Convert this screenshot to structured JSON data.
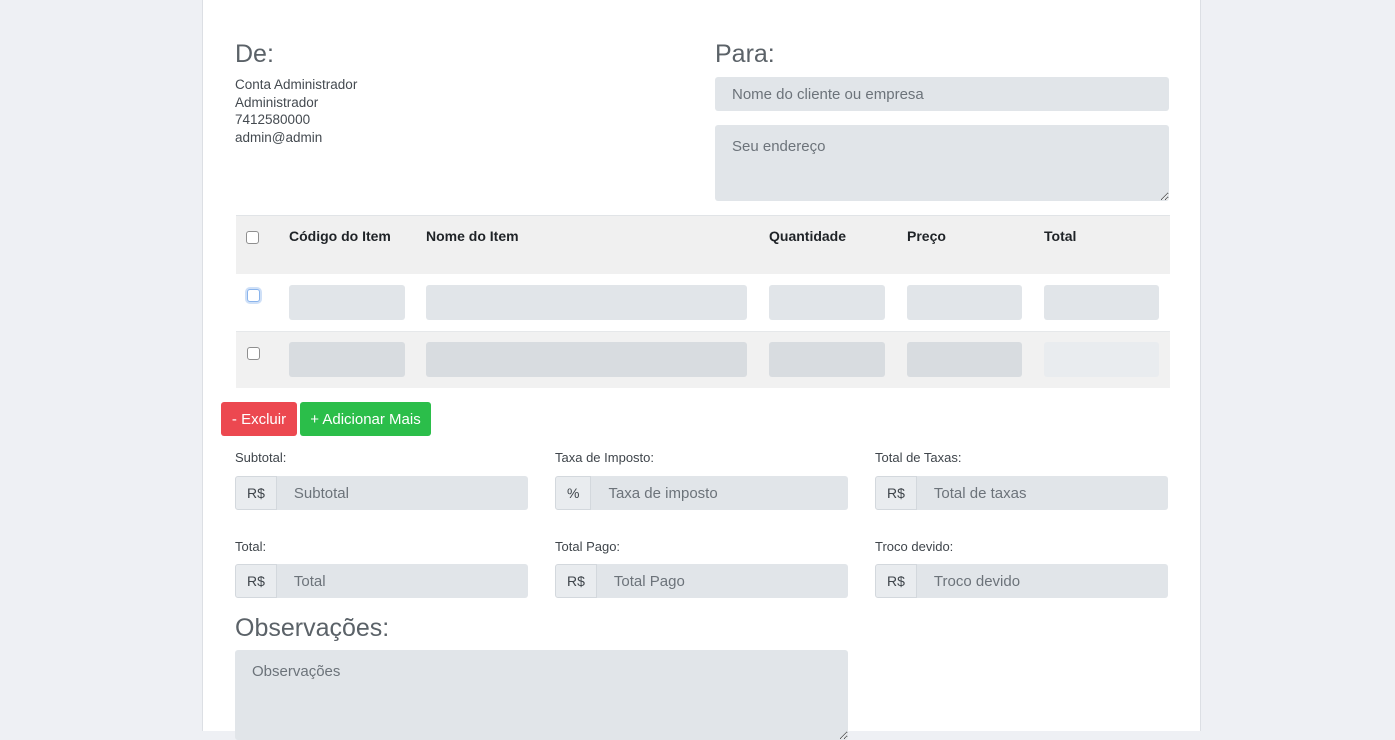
{
  "from": {
    "title": "De:",
    "name": "Conta Administrador",
    "role": "Administrador",
    "phone": "7412580000",
    "email": "admin@admin"
  },
  "to": {
    "title": "Para:",
    "client_placeholder": "Nome do cliente ou empresa",
    "address_placeholder": "Seu endereço"
  },
  "items_table": {
    "columns": [
      "Código do Item",
      "Nome do Item",
      "Quantidade",
      "Preço",
      "Total"
    ],
    "rows": [
      {
        "code": "",
        "name": "",
        "quantity": "",
        "price": "",
        "total": ""
      },
      {
        "code": "",
        "name": "",
        "quantity": "",
        "price": "",
        "total": ""
      }
    ]
  },
  "actions": {
    "delete_label": "- Excluir",
    "add_label": "+ Adicionar Mais",
    "delete_color": "#ec4850",
    "add_color": "#2bbe4a"
  },
  "totals": {
    "subtotal": {
      "label": "Subtotal:",
      "addon": "R$",
      "placeholder": "Subtotal"
    },
    "tax_rate": {
      "label": "Taxa de Imposto:",
      "addon": "%",
      "placeholder": "Taxa de imposto"
    },
    "tax_total": {
      "label": "Total de Taxas:",
      "addon": "R$",
      "placeholder": "Total de taxas"
    },
    "total": {
      "label": "Total:",
      "addon": "R$",
      "placeholder": "Total"
    },
    "paid": {
      "label": "Total Pago:",
      "addon": "R$",
      "placeholder": "Total Pago"
    },
    "change": {
      "label": "Troco devido:",
      "addon": "R$",
      "placeholder": "Troco devido"
    }
  },
  "notes": {
    "title": "Observações:",
    "placeholder": "Observações"
  }
}
